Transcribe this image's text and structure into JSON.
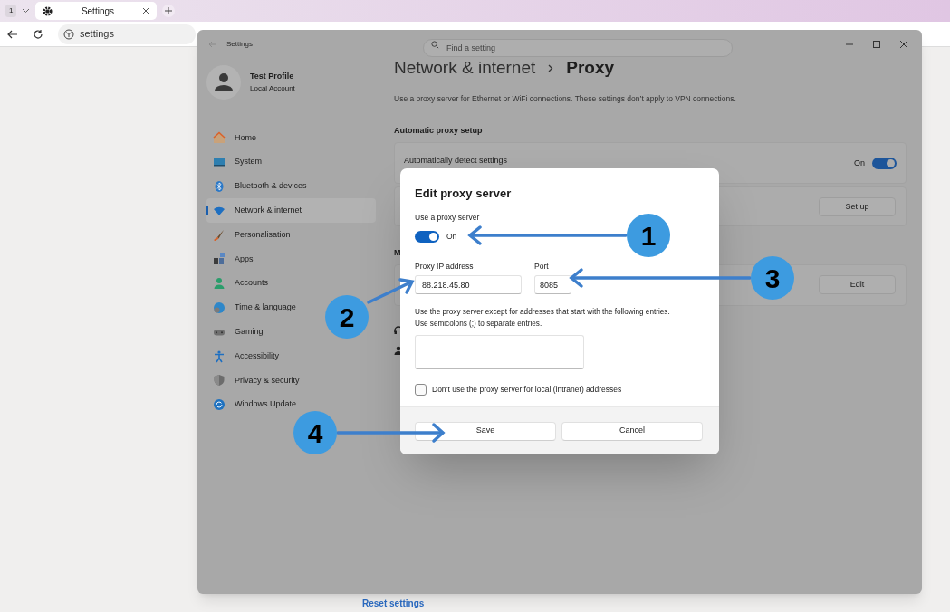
{
  "browser": {
    "tab_count": "1",
    "tab_title": "Settings",
    "address": "settings"
  },
  "window": {
    "title": "Settings",
    "search": {
      "placeholder": "Find a setting"
    }
  },
  "profile": {
    "name": "Test Profile",
    "account": "Local Account"
  },
  "sidebar": {
    "items": [
      {
        "label": "Home",
        "kind": "home",
        "selected": false
      },
      {
        "label": "System",
        "kind": "system",
        "selected": false
      },
      {
        "label": "Bluetooth & devices",
        "kind": "bluetooth",
        "selected": false
      },
      {
        "label": "Network & internet",
        "kind": "wifi",
        "selected": true
      },
      {
        "label": "Personalisation",
        "kind": "brush",
        "selected": false
      },
      {
        "label": "Apps",
        "kind": "apps",
        "selected": false
      },
      {
        "label": "Accounts",
        "kind": "person",
        "selected": false
      },
      {
        "label": "Time & language",
        "kind": "globe",
        "selected": false
      },
      {
        "label": "Gaming",
        "kind": "gamepad",
        "selected": false
      },
      {
        "label": "Accessibility",
        "kind": "accessibility",
        "selected": false
      },
      {
        "label": "Privacy & security",
        "kind": "shield",
        "selected": false
      },
      {
        "label": "Windows Update",
        "kind": "update",
        "selected": false
      }
    ]
  },
  "page": {
    "breadcrumb": [
      "Network & internet",
      "Proxy"
    ],
    "description": "Use a proxy server for Ethernet or WiFi connections. These settings don’t apply to VPN connections.",
    "automatic": {
      "heading": "Automatic proxy setup",
      "detect_label": "Automatically detect settings",
      "detect_state": "On",
      "detect_on": true,
      "setup_button": "Set up"
    },
    "manual": {
      "heading": "M",
      "edit_button": "Edit"
    },
    "reset_link": "Reset settings"
  },
  "dialog": {
    "title": "Edit proxy server",
    "proxy_label": "Use a proxy server",
    "proxy_on": true,
    "proxy_state": "On",
    "ip": {
      "label": "Proxy IP address",
      "value": "88.218.45.80"
    },
    "port": {
      "label": "Port",
      "value": "8085"
    },
    "exceptions_help": [
      "Use the proxy server except for addresses that start with the following entries.",
      "Use semicolons (;) to separate entries."
    ],
    "local_checkbox": {
      "label": "Don’t use the proxy server for local (intranet) addresses",
      "checked": false
    },
    "buttons": [
      "Save",
      "Cancel"
    ]
  },
  "callouts": [
    {
      "label": "1"
    },
    {
      "label": "2"
    },
    {
      "label": "3"
    },
    {
      "label": "4"
    }
  ]
}
